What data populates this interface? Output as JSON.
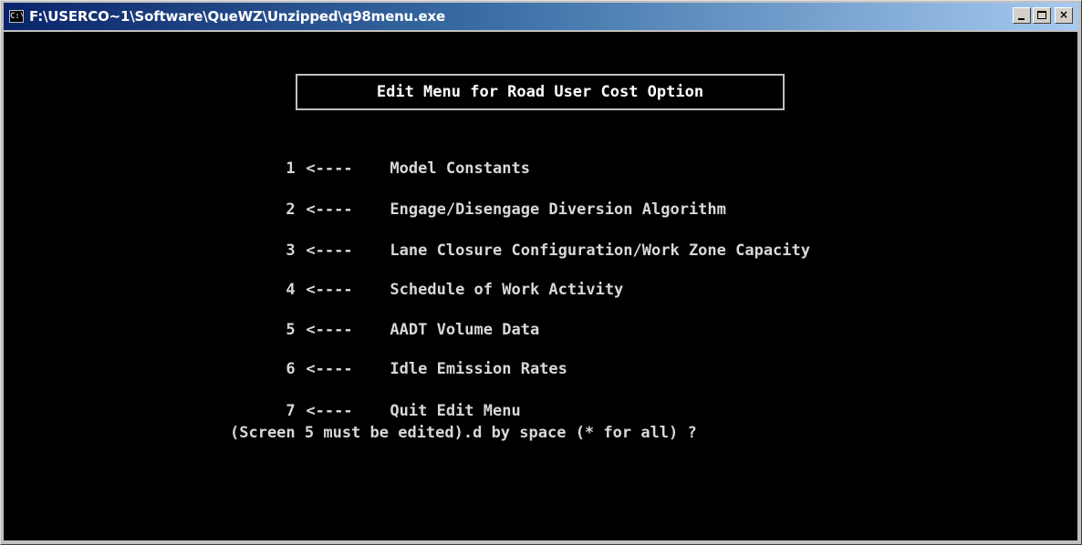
{
  "window": {
    "title": "F:\\USERCO~1\\Software\\QueWZ\\Unzipped\\q98menu.exe",
    "icon": "console-icon",
    "controls": {
      "minimize": "minimize-icon",
      "maximize": "maximize-icon",
      "close_label": "×"
    }
  },
  "console": {
    "header": "Edit Menu for Road User Cost Option",
    "arrow": "<----",
    "menu": [
      {
        "number": "1",
        "label": "Model Constants"
      },
      {
        "number": "2",
        "label": "Engage/Disengage Diversion Algorithm"
      },
      {
        "number": "3",
        "label": "Lane Closure Configuration/Work Zone Capacity"
      },
      {
        "number": "4",
        "label": "Schedule of Work Activity"
      },
      {
        "number": "5",
        "label": "AADT Volume Data"
      },
      {
        "number": "6",
        "label": "Idle Emission Rates"
      },
      {
        "number": "7",
        "label": "Quit Edit Menu"
      }
    ],
    "prompt": "(Screen 5 must be edited).d by space (* for all) ?"
  }
}
